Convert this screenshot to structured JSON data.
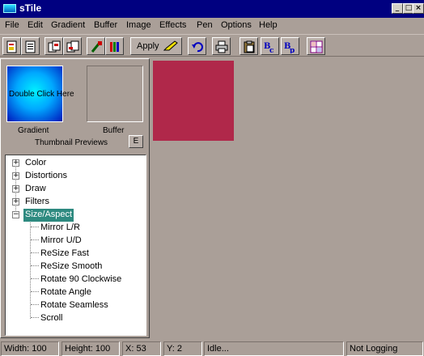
{
  "window": {
    "title": "sTile"
  },
  "menu": [
    "File",
    "Edit",
    "Gradient",
    "Buffer",
    "Image",
    "Effects",
    "Pen",
    "Options",
    "Help"
  ],
  "toolbar": {
    "apply_label": "Apply"
  },
  "thumbnails": {
    "gradient_overlay_text": "Double Click Here",
    "gradient_label": "Gradient",
    "buffer_label": "Buffer",
    "previews_label": "Thumbnail Previews",
    "e_button_label": "E"
  },
  "tree": {
    "categories": [
      "Color",
      "Distortions",
      "Draw",
      "Filters",
      "Size/Aspect"
    ],
    "selected": "Size/Aspect",
    "children": [
      "Mirror L/R",
      "Mirror U/D",
      "ReSize Fast",
      "ReSize Smooth",
      "Rotate 90 Clockwise",
      "Rotate Angle",
      "Rotate Seamless",
      "Scroll"
    ]
  },
  "canvas": {
    "swatch_color": "#b0284a"
  },
  "status": {
    "width": "Width: 100",
    "height": "Height: 100",
    "x": "X: 53",
    "y": "Y: 2",
    "message": "Idle...",
    "logging": "Not Logging"
  }
}
